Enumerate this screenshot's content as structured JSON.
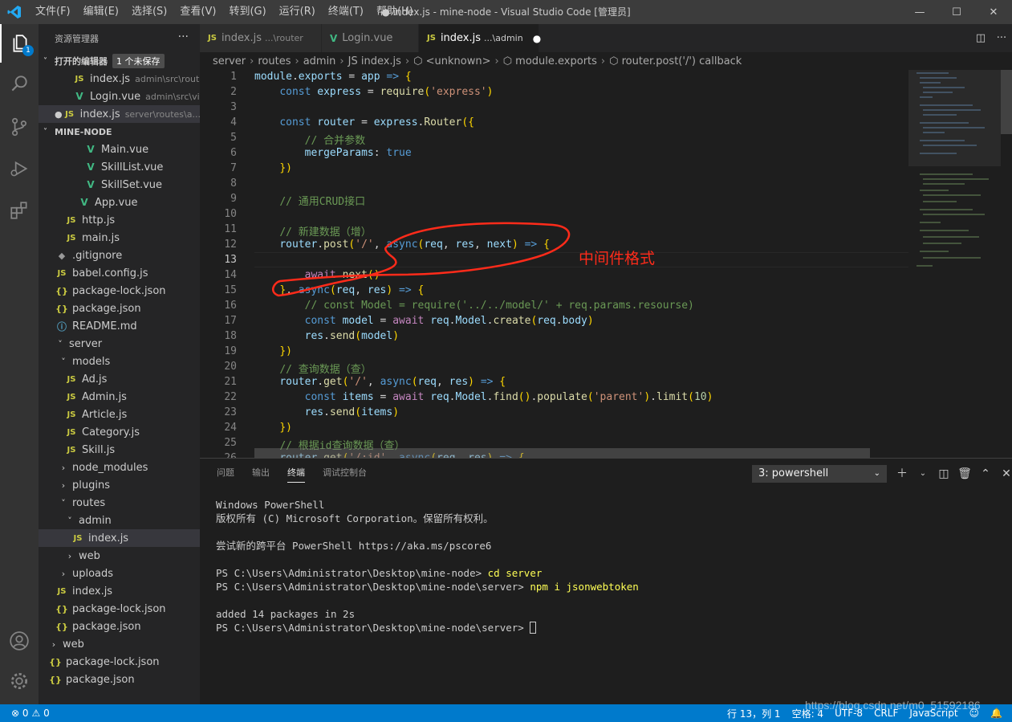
{
  "titlebar": {
    "menus": [
      "文件(F)",
      "编辑(E)",
      "选择(S)",
      "查看(V)",
      "转到(G)",
      "运行(R)",
      "终端(T)",
      "帮助(H)"
    ],
    "title": "● index.js - mine-node - Visual Studio Code [管理员]"
  },
  "activity": {
    "badge": "1"
  },
  "sidebar": {
    "header": "资源管理器",
    "open_editors": {
      "label": "打开的编辑器",
      "unsaved": "1 个未保存",
      "items": [
        {
          "icon": "JS",
          "name": "index.js",
          "desc": "admin\\src\\router"
        },
        {
          "icon": "V",
          "name": "Login.vue",
          "desc": "admin\\src\\vi..."
        },
        {
          "icon": "JS",
          "name": "index.js",
          "desc": "server\\routes\\a..."
        }
      ]
    },
    "project": "MINE-NODE",
    "tree": [
      {
        "icon": "V",
        "name": "Main.vue"
      },
      {
        "icon": "V",
        "name": "SkillList.vue"
      },
      {
        "icon": "V",
        "name": "SkillSet.vue"
      },
      {
        "icon": "V",
        "name": "App.vue"
      },
      {
        "icon": "JS",
        "name": "http.js"
      },
      {
        "icon": "JS",
        "name": "main.js"
      },
      {
        "icon": "◆",
        "name": ".gitignore"
      },
      {
        "icon": "JS",
        "name": "babel.config.js"
      },
      {
        "icon": "{}",
        "name": "package-lock.json"
      },
      {
        "icon": "{}",
        "name": "package.json"
      },
      {
        "icon": "ⓘ",
        "name": "README.md"
      },
      {
        "icon": "˅",
        "name": "server"
      },
      {
        "icon": "˅",
        "name": "models"
      },
      {
        "icon": "JS",
        "name": "Ad.js"
      },
      {
        "icon": "JS",
        "name": "Admin.js"
      },
      {
        "icon": "JS",
        "name": "Article.js"
      },
      {
        "icon": "JS",
        "name": "Category.js"
      },
      {
        "icon": "JS",
        "name": "Skill.js"
      },
      {
        "icon": "›",
        "name": "node_modules"
      },
      {
        "icon": "›",
        "name": "plugins"
      },
      {
        "icon": "˅",
        "name": "routes"
      },
      {
        "icon": "˅",
        "name": "admin"
      },
      {
        "icon": "JS",
        "name": "index.js"
      },
      {
        "icon": "›",
        "name": "web"
      },
      {
        "icon": "›",
        "name": "uploads"
      },
      {
        "icon": "JS",
        "name": "index.js"
      },
      {
        "icon": "{}",
        "name": "package-lock.json"
      },
      {
        "icon": "{}",
        "name": "package.json"
      },
      {
        "icon": "›",
        "name": "web"
      },
      {
        "icon": "{}",
        "name": "package-lock.json"
      },
      {
        "icon": "{}",
        "name": "package.json"
      }
    ]
  },
  "tabs": [
    {
      "icon": "JS",
      "name": "index.js",
      "path": "...\\router"
    },
    {
      "icon": "V",
      "name": "Login.vue",
      "path": ""
    },
    {
      "icon": "JS",
      "name": "index.js",
      "path": "...\\admin",
      "dirty": "●"
    }
  ],
  "breadcrumbs": [
    "server",
    "routes",
    "admin",
    "JS index.js",
    "⬡ <unknown>",
    "⬡ module.exports",
    "⬡ router.post('/') callback"
  ],
  "code_lines": [
    "module.exports = app => {",
    "    const express = require('express')",
    "",
    "    const router = express.Router({",
    "        // 合并参数",
    "        mergeParams: true",
    "    })",
    "",
    "    // 通用CRUD接口",
    "",
    "    // 新建数据（增）",
    "    router.post('/', async(req, res, next) => {",
    "",
    "        await next()",
    "    }, async(req, res) => {",
    "        // const Model = require('../../model/' + req.params.resourse)",
    "        const model = await req.Model.create(req.body)",
    "        res.send(model)",
    "    })",
    "    // 查询数据（查）",
    "    router.get('/', async(req, res) => {",
    "        const items = await req.Model.find().populate('parent').limit(10)",
    "        res.send(items)",
    "    })",
    "    // 根据id查询数据（查）",
    "    router.get('/:id', async(req, res) => {"
  ],
  "annotation": "中间件格式",
  "panel": {
    "tabs": [
      "问题",
      "输出",
      "终端",
      "调试控制台"
    ],
    "active_tab": "终端",
    "terminal_select": "3: powershell",
    "terminal_lines": [
      "Windows PowerShell",
      "版权所有 (C) Microsoft Corporation。保留所有权利。",
      "",
      "尝试新的跨平台 PowerShell https://aka.ms/pscore6",
      "",
      "PS C:\\Users\\Administrator\\Desktop\\mine-node> ",
      "PS C:\\Users\\Administrator\\Desktop\\mine-node\\server> ",
      "",
      "added 14 packages in 2s",
      "PS C:\\Users\\Administrator\\Desktop\\mine-node\\server> "
    ],
    "commands": {
      "cd": "cd server",
      "npm": "npm i jsonwebtoken"
    }
  },
  "status": {
    "errors": "⊗ 0",
    "warnings": "⚠ 0",
    "position": "行 13，列 1",
    "spaces": "空格: 4",
    "encoding": "UTF-8",
    "eol": "CRLF",
    "language": "JavaScript"
  },
  "watermark": "https://blog.csdn.net/m0_51592186",
  "colors": {
    "accent": "#007acc",
    "annotation": "#ff2b1a",
    "vue": "#41b883",
    "js": "#cbcb41"
  }
}
